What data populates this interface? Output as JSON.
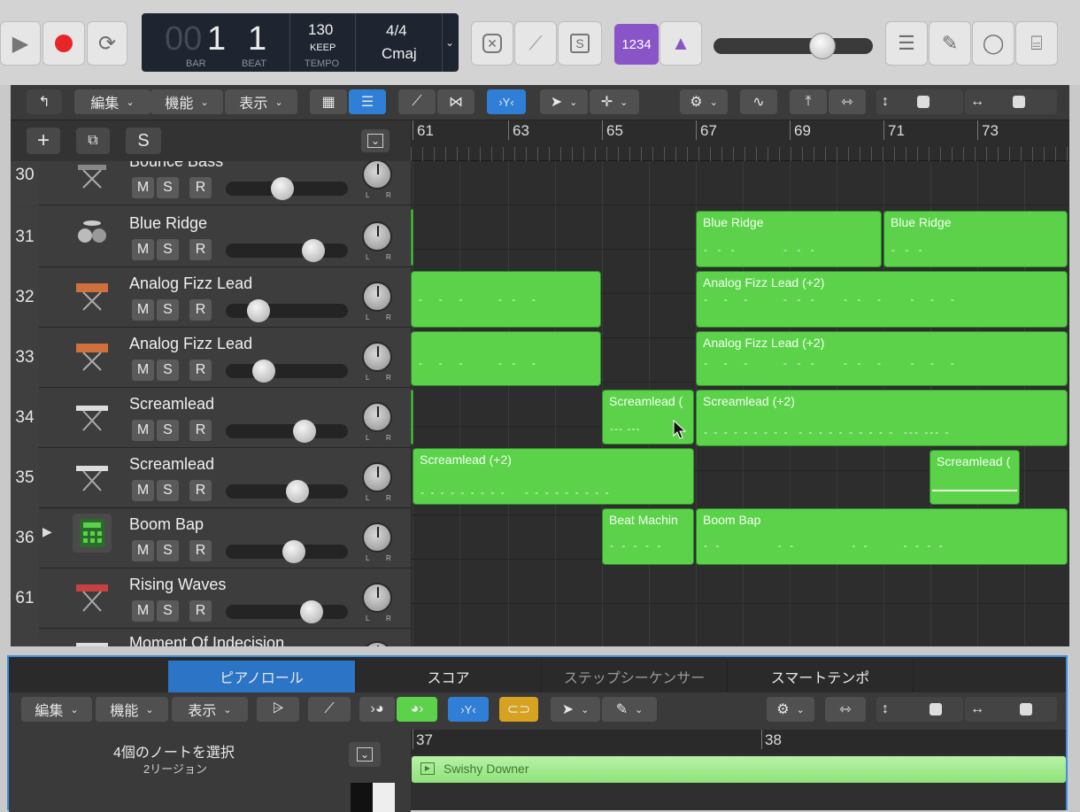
{
  "transport": {
    "play_icon": "play-icon",
    "record_icon": "record-icon",
    "cycle_icon": "cycle-icon"
  },
  "lcd": {
    "bar_dim": "00",
    "bar": "1",
    "beat": "1",
    "bar_label": "BAR",
    "beat_label": "BEAT",
    "tempo": "130",
    "tempo_mode": "KEEP",
    "tempo_label": "TEMPO",
    "signature": "4/4",
    "key": "Cmaj"
  },
  "count_in": {
    "label": "1234"
  },
  "solo_label": "S",
  "tracks_toolbar": {
    "menus": [
      "編集",
      "機能",
      "表示"
    ]
  },
  "header_toolbar": {
    "solo_label": "S"
  },
  "ruler": {
    "bars": [
      "61",
      "63",
      "65",
      "67",
      "69",
      "71",
      "73"
    ]
  },
  "tracks": [
    {
      "num": "30",
      "name": "Bounce Bass",
      "icon": "keyboard-stand-icon"
    },
    {
      "num": "31",
      "name": "Blue Ridge",
      "icon": "drum-kit-icon"
    },
    {
      "num": "32",
      "name": "Analog Fizz Lead",
      "icon": "synth-stand-icon"
    },
    {
      "num": "33",
      "name": "Analog Fizz Lead",
      "icon": "synth-stand-icon"
    },
    {
      "num": "34",
      "name": "Screamlead",
      "icon": "keyboard-stand-icon"
    },
    {
      "num": "35",
      "name": "Screamlead",
      "icon": "keyboard-stand-icon"
    },
    {
      "num": "36",
      "name": "Boom Bap",
      "icon": "drum-machine-icon"
    },
    {
      "num": "61",
      "name": "Rising Waves",
      "icon": "synth-stand-icon"
    },
    {
      "num": "",
      "name": "Moment Of Indecision",
      "icon": "keyboard-stand-icon"
    }
  ],
  "track_buttons": {
    "mute": "M",
    "solo": "S",
    "record": "R",
    "pan_left": "L",
    "pan_right": "R"
  },
  "regions": {
    "r31a": "Blue Ridge",
    "r31b": "Blue Ridge",
    "r32b": "Analog Fizz Lead (+2)",
    "r33b": "Analog Fizz Lead (+2)",
    "r34a": "Screamlead (",
    "r34b": "Screamlead (+2)",
    "r35a": "Screamlead (+2)",
    "r35b": "Screamlead (",
    "r36a": "Beat Machin",
    "r36b": "Boom Bap"
  },
  "editor": {
    "tabs": [
      "ピアノロール",
      "スコア",
      "ステップシーケンサー",
      "スマートテンポ"
    ],
    "menus": [
      "編集",
      "機能",
      "表示"
    ],
    "selection_info": "4個のノートを選択",
    "region_count": "2リージョン",
    "ruler": [
      "37",
      "38"
    ],
    "region_name": "Swishy Downer"
  }
}
